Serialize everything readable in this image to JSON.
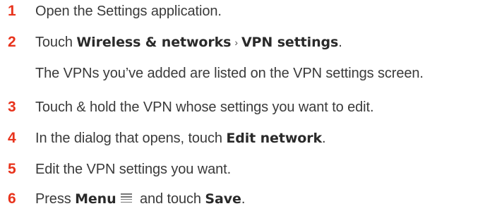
{
  "steps": [
    {
      "num": "1",
      "text": "Open the Settings application."
    },
    {
      "num": "2",
      "pre": "Touch ",
      "b1": "Wireless & networks",
      "sep": "›",
      "b2": "VPN settings",
      "post": "."
    },
    {
      "note": "The VPNs you’ve added are listed on the VPN settings screen."
    },
    {
      "num": "3",
      "text": "Touch & hold the VPN whose settings you want to edit."
    },
    {
      "num": "4",
      "pre": "In the dialog that opens, touch ",
      "b1": "Edit network",
      "post": "."
    },
    {
      "num": "5",
      "text": "Edit the VPN settings you want."
    },
    {
      "num": "6",
      "pre": "Press ",
      "b1": "Menu",
      "icon": "menu-icon",
      "mid": " and touch ",
      "b2": "Save",
      "post": "."
    }
  ]
}
